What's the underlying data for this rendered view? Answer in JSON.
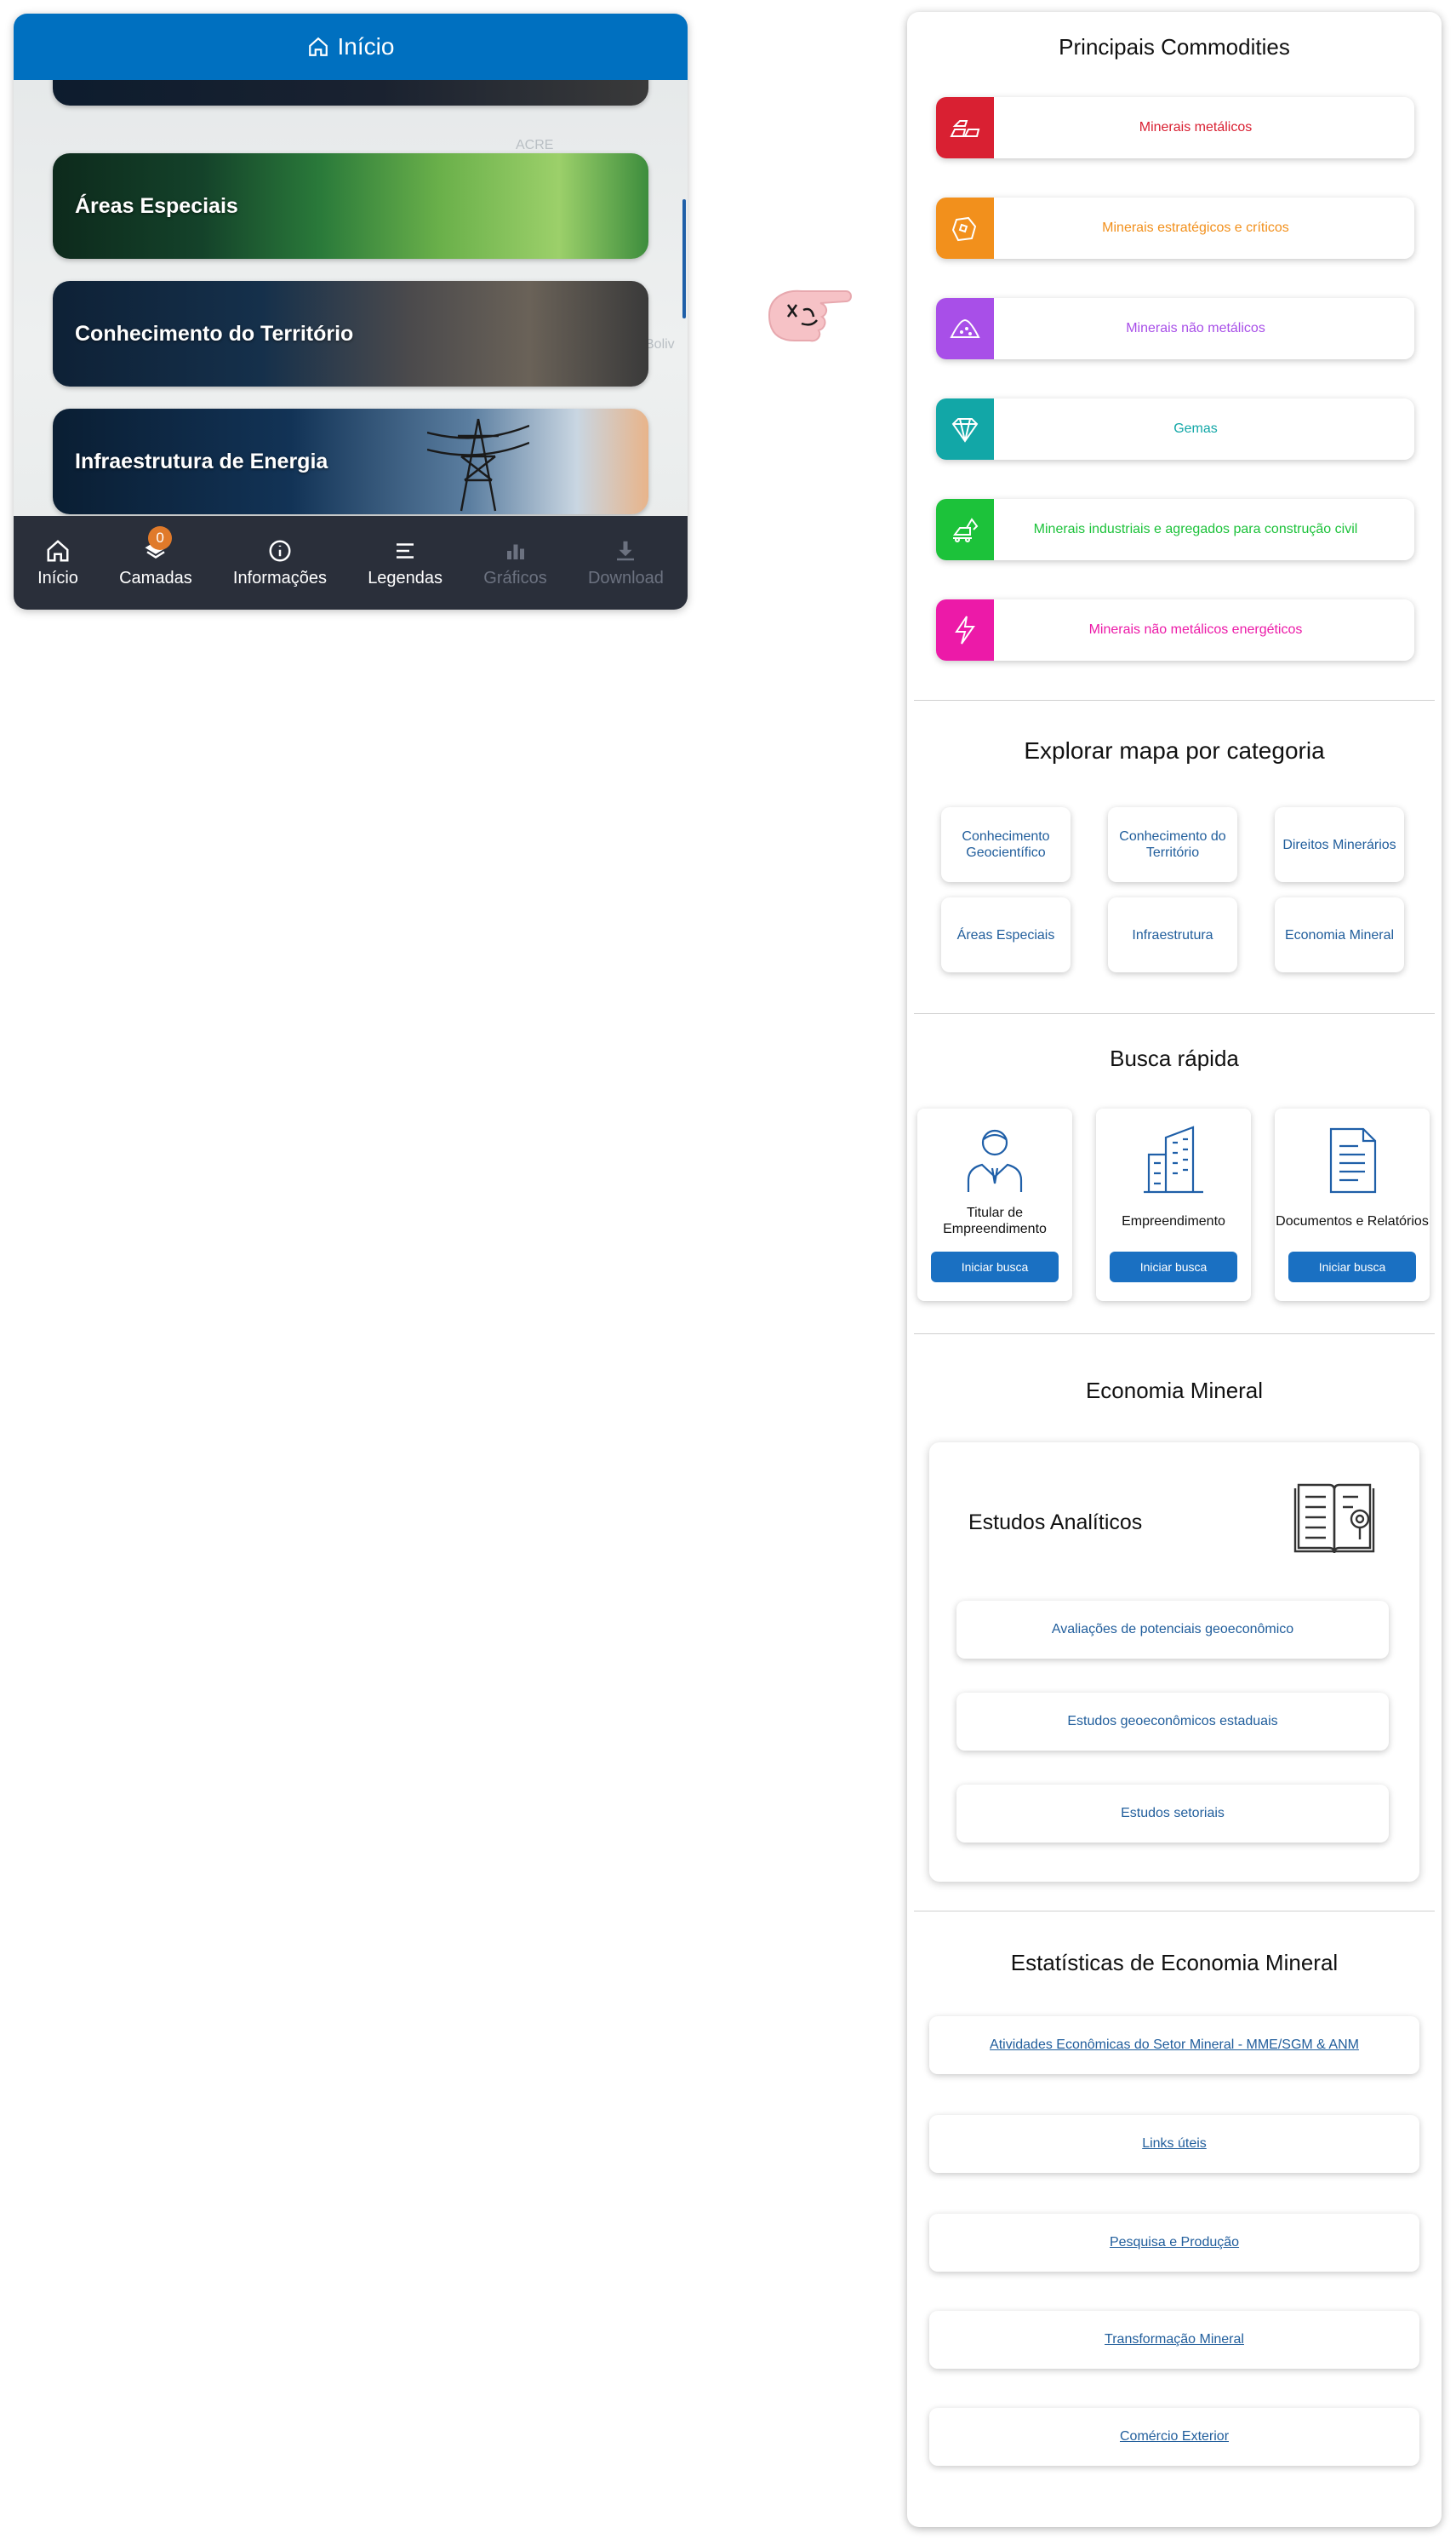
{
  "phone": {
    "header_title": "Início",
    "cards": [
      "",
      "Áreas Especiais",
      "Conhecimento do Território",
      "Infraestrutura de Energia"
    ],
    "nav": [
      {
        "label": "Início",
        "icon": "home-icon",
        "enabled": true
      },
      {
        "label": "Camadas",
        "icon": "layers-icon",
        "enabled": true,
        "badge": "0"
      },
      {
        "label": "Informações",
        "icon": "info-icon",
        "enabled": true
      },
      {
        "label": "Legendas",
        "icon": "legend-icon",
        "enabled": true
      },
      {
        "label": "Gráficos",
        "icon": "chart-icon",
        "enabled": false
      },
      {
        "label": "Download",
        "icon": "download-icon",
        "enabled": false
      }
    ],
    "accent": "#0070c0",
    "nav_bg": "#2a2f3a",
    "badge_color": "#e07a2a"
  },
  "panel": {
    "commodities": {
      "title": "Principais Commodities",
      "items": [
        {
          "label": "Minerais metálicos",
          "color": "#d92032",
          "icon": "gold-bars-icon"
        },
        {
          "label": "Minerais estratégicos e críticos",
          "color": "#f2901c",
          "icon": "mineral-rock-icon"
        },
        {
          "label": "Minerais não metálicos",
          "color": "#a84fe8",
          "icon": "sand-pile-icon"
        },
        {
          "label": "Gemas",
          "color": "#12a7a7",
          "icon": "diamond-icon"
        },
        {
          "label": "Minerais industriais e agregados para construção civil",
          "color": "#1cc23a",
          "icon": "excavator-icon"
        },
        {
          "label": "Minerais não metálicos energéticos",
          "color": "#ec1aa8",
          "icon": "lightning-icon"
        }
      ]
    },
    "explore": {
      "title": "Explorar mapa por categoria",
      "items": [
        "Conhecimento Geocientífico",
        "Conhecimento do Território",
        "Direitos Minerários",
        "Áreas Especiais",
        "Infraestrutura",
        "Economia Mineral"
      ]
    },
    "quick_search": {
      "title": "Busca rápida",
      "items": [
        {
          "label": "Titular de Empreendimento",
          "button": "Iniciar busca",
          "icon": "person-icon"
        },
        {
          "label": "Empreendimento",
          "button": "Iniciar busca",
          "icon": "buildings-icon"
        },
        {
          "label": "Documentos e Relatórios",
          "button": "Iniciar busca",
          "icon": "document-icon"
        }
      ]
    },
    "economy": {
      "title": "Economia Mineral",
      "card_title": "Estudos Analíticos",
      "items": [
        "Avaliações de potenciais geoeconômico",
        "Estudos geoeconômicos estaduais",
        "Estudos setoriais"
      ]
    },
    "stats": {
      "title": "Estatísticas de Economia Mineral",
      "items": [
        "Atividades Econômicas do Setor Mineral - MME/SGM & ANM",
        "Links úteis",
        "Pesquisa e Produção",
        "Transformação Mineral",
        "Comércio Exterior"
      ]
    },
    "link_color": "#215e9c",
    "button_color": "#1a70c2"
  }
}
